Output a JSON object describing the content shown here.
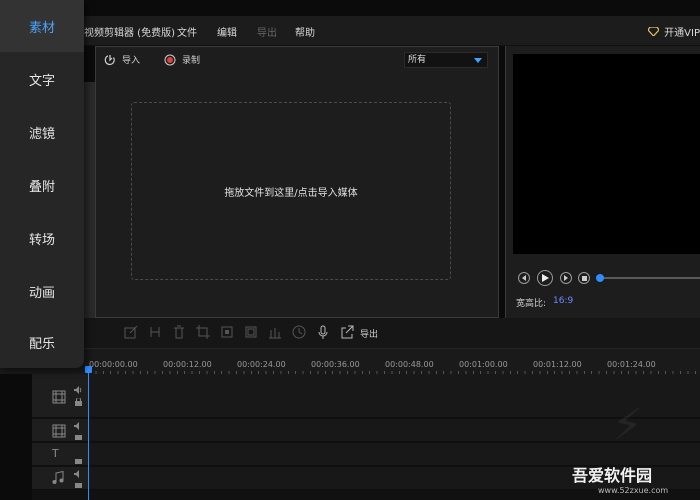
{
  "menu": {
    "app_title": "视频剪辑器 (免费版)",
    "file": "文件",
    "edit": "编辑",
    "export": "导出",
    "help": "帮助",
    "vip": "开通VIP"
  },
  "sidebar": {
    "items": [
      {
        "label": "素材",
        "active": true
      },
      {
        "label": "文字"
      },
      {
        "label": "滤镜"
      },
      {
        "label": "叠附"
      },
      {
        "label": "转场"
      },
      {
        "label": "动画"
      },
      {
        "label": "配乐"
      }
    ]
  },
  "media": {
    "import_label": "导入",
    "record_label": "录制",
    "filter_value": "所有",
    "dropzone_text": "拖放文件到这里/点击导入媒体"
  },
  "preview": {
    "ratio_label": "宽高比:",
    "ratio_value": "16:9",
    "progress": 0
  },
  "toolbar": {
    "export_label": "导出"
  },
  "timeline": {
    "timestamps": [
      "00:00:00.00",
      "00:00:12.00",
      "00:00:24.00",
      "00:00:36.00",
      "00:00:48.00",
      "00:01:00.00",
      "00:01:12.00",
      "00:01:24.00"
    ]
  },
  "watermark": {
    "brand": "吾爱软件园",
    "url": "www.52zxue.com"
  },
  "colors": {
    "accent": "#2f8cff",
    "vip": "#e9c46a",
    "record": "#e04040"
  }
}
